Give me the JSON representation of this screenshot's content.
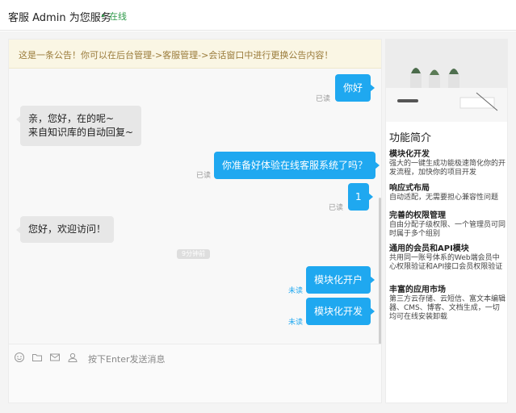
{
  "header": {
    "title": "客服  Admin 为您服务",
    "status": "在线"
  },
  "notice": "这是一条公告！你可以在后台管理->客服管理->会话窗口中进行更换公告内容！",
  "messages": [
    {
      "side": "right",
      "text": "你好",
      "status": "已读"
    },
    {
      "side": "left",
      "lines": [
        "亲，您好，在的呢~",
        "来自知识库的自动回复~"
      ]
    },
    {
      "side": "right",
      "text": "你准备好体验在线客服系统了吗？",
      "status": "已读"
    },
    {
      "side": "right",
      "text": "1",
      "status": "已读"
    },
    {
      "side": "left",
      "text": "您好，欢迎访问！"
    },
    {
      "side": "right",
      "text": "模块化开户",
      "status": "未读"
    },
    {
      "side": "right",
      "text": "模块化开发",
      "status": "未读"
    }
  ],
  "time_chip": "9分钟前",
  "composer": {
    "hint": "按下Enter发送消息",
    "tools": [
      "emoji-icon",
      "folder-icon",
      "mail-icon",
      "support-agent-icon"
    ]
  },
  "sidebar": {
    "title": "功能简介",
    "features": [
      {
        "title": "模块化开发",
        "desc": "强大的一键生成功能极速简化你的开发流程，加快你的项目开发"
      },
      {
        "title": "响应式布局",
        "desc": "自动适配，无需要担心兼容性问题"
      },
      {
        "title": "完善的权限管理",
        "desc": "自由分配子级权限、一个管理员可同时属于多个组别"
      },
      {
        "title": "通用的会员和API模块",
        "desc": "共用同一账号体系的Web端会员中心权限验证和API接口会员权限验证"
      },
      {
        "title": "丰富的应用市场",
        "desc": "第三方云存储、云短信、富文本编辑器、CMS、博客、文档生成，一切均可在线安装卸载"
      }
    ]
  },
  "colors": {
    "accent": "#1fa8f0",
    "online": "#2f9a4a",
    "notice_text": "#9a7b3a"
  }
}
